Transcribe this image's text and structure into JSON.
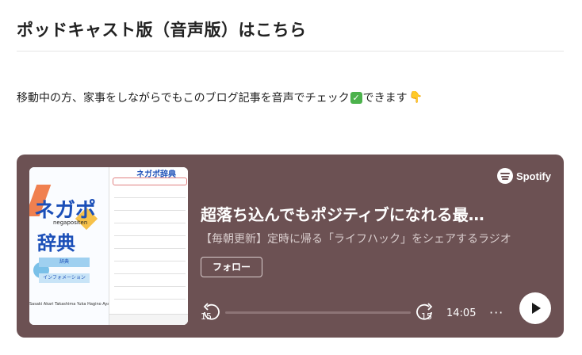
{
  "article": {
    "heading": "ポッドキャスト版（音声版）はこちら",
    "intro_before": "移動中の方、家事をしながらでもこのブログ記事を音声でチェック",
    "intro_after": "できます"
  },
  "embed": {
    "brand": "Spotify",
    "title": "超落ち込んでもポジティブになれる最…",
    "subtitle": "【毎朝更新】定時に帰る「ライフハック」をシェアするラジオ",
    "follow_label": "フォロー",
    "skip_back_label": "15",
    "skip_forward_label": "15",
    "duration": "14:05",
    "more_label": "···",
    "background_color": "#6c5153",
    "progress": 0
  },
  "cover": {
    "logo_main": "ネガポ",
    "logo_sub": "negapositen",
    "logo_dict": "辞典",
    "header_logo": "ネガポ辞典",
    "button_a": "辞典",
    "button_b": "インフォメーション",
    "credits": "Sasaki Akari   Takashima Yuka   Hagino Ayako"
  }
}
